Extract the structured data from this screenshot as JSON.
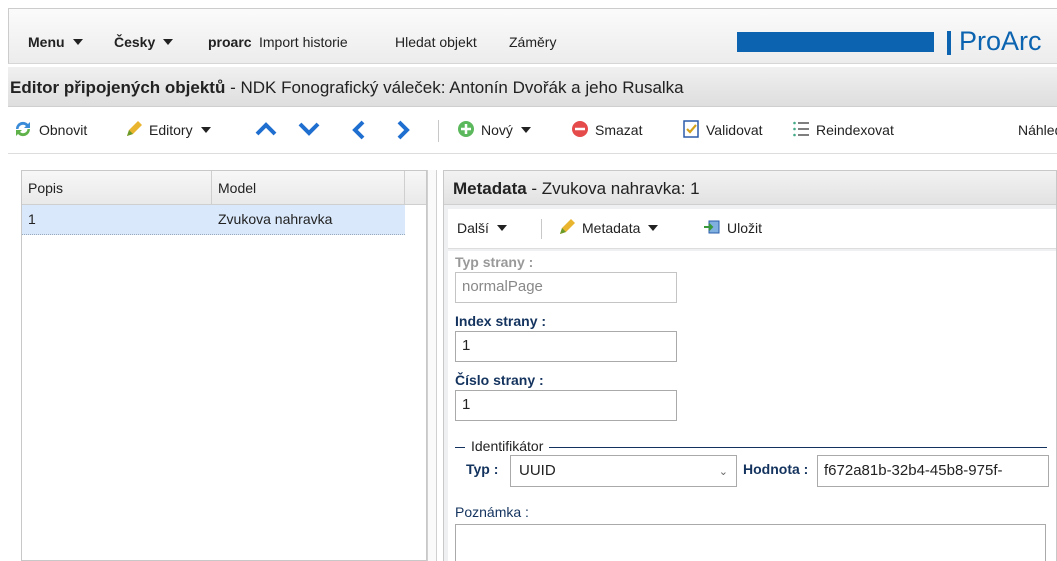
{
  "topmenu": {
    "menu": "Menu",
    "language": "Česky",
    "user": "proarc",
    "import_history": "Import historie",
    "find_object": "Hledat objekt",
    "intents": "Záměry",
    "brand": "ProArc"
  },
  "titlebar": {
    "title_bold": "Editor připojených objektů",
    "title_rest": " - NDK Fonografický váleček: Antonín Dvořák a jeho Rusalka"
  },
  "toolbar": {
    "refresh": "Obnovit",
    "editors": "Editory",
    "new": "Nový",
    "delete": "Smazat",
    "validate": "Validovat",
    "reindex": "Reindexovat",
    "preview": "Náhled"
  },
  "grid": {
    "columns": [
      "Popis",
      "Model"
    ],
    "rows": [
      {
        "popis": "1",
        "model": "Zvukova nahravka"
      }
    ]
  },
  "metadata_panel": {
    "title_bold": "Metadata",
    "title_rest": " - Zvukova nahravka: 1",
    "more": "Další",
    "metadata_menu": "Metadata",
    "save": "Uložit"
  },
  "form": {
    "page_type_label": "Typ strany :",
    "page_type_value": "normalPage",
    "page_index_label": "Index strany :",
    "page_index_value": "1",
    "page_number_label": "Číslo strany :",
    "page_number_value": "1",
    "identifier_legend": "Identifikátor",
    "type_label": "Typ :",
    "type_value": "UUID",
    "value_label": "Hodnota :",
    "value_value": "f672a81b-32b4-45b8-975f-",
    "note_label": "Poznámka :"
  }
}
